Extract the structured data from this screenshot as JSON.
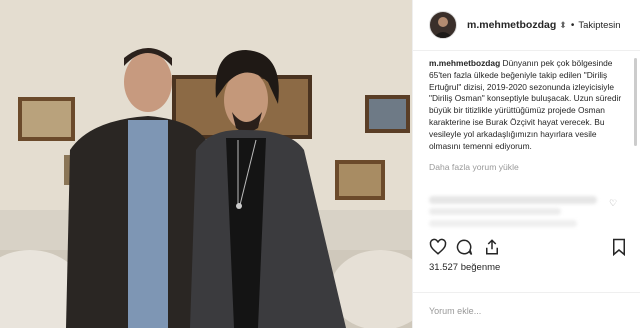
{
  "post": {
    "username": "m.mehmetbozdag",
    "follow_label": "Takiptesin",
    "caption_text": "Dünyanın pek çok bölgesinde 65'ten fazla ülkede beğeniyle takip edilen \"Diriliş Ertuğrul\" dizisi, 2019-2020 sezonunda izleyicisiyle \"Diriliş Osman\" konseptiyle buluşacak. Uzun süredir büyük bir titizlikle yürüttüğümüz projede Osman karakterine ise Burak Özçivit hayat verecek. Bu vesileyle yol arkadaşlığımızın hayırlara vesile olmasını temenni ediyorum.",
    "load_more_comments": "Daha fazla yorum yükle",
    "likes_count": "31.527 beğenme",
    "comment_placeholder": "Yorum ekle..."
  },
  "icons": {
    "like": "heart-icon",
    "comment": "comment-icon",
    "share": "share-icon",
    "save": "bookmark-icon",
    "more": "more-options-icon"
  },
  "colors": {
    "text": "#262626",
    "muted": "#999999",
    "border": "#efefef"
  }
}
